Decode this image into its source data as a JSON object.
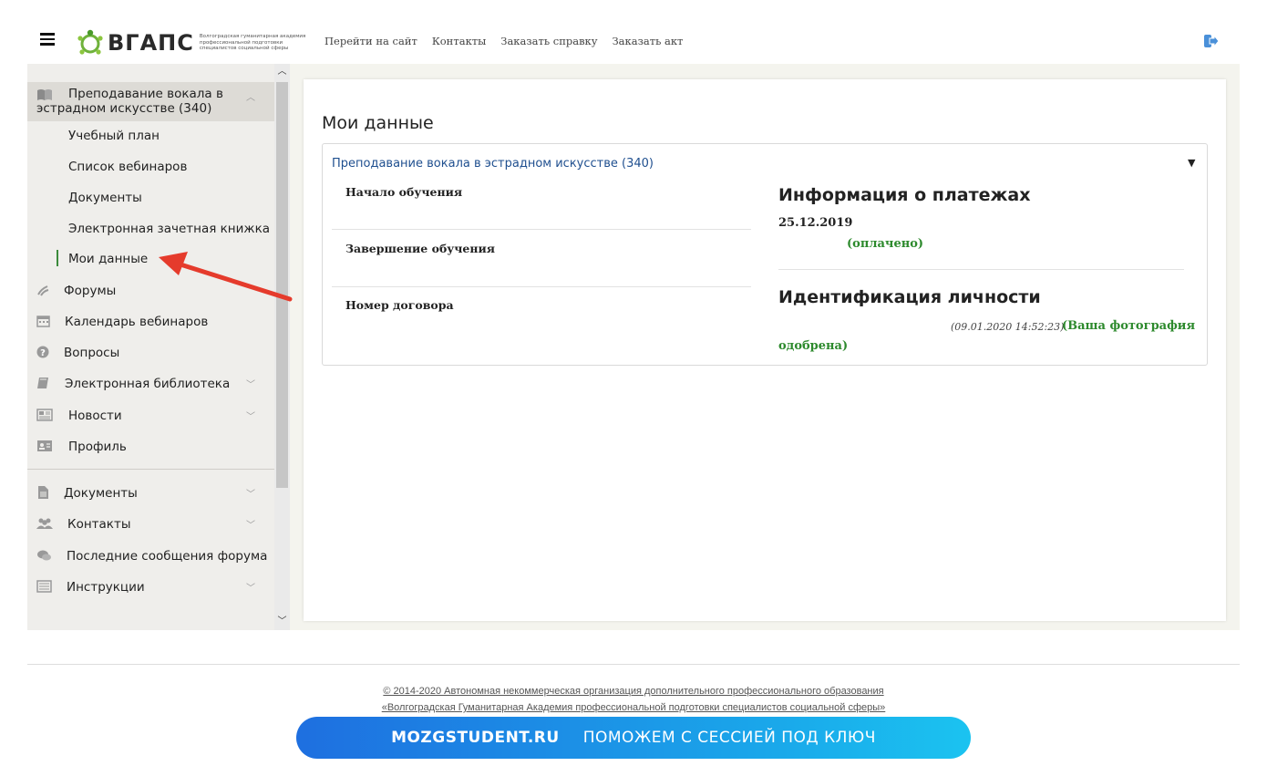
{
  "header": {
    "logo_text": "ВГАПС",
    "logo_subtitle": "Волгоградская гуманитарная академия профессиональной подготовки специалистов социальной сферы",
    "nav": [
      "Перейти на сайт",
      "Контакты",
      "Заказать справку",
      "Заказать акт"
    ],
    "logout_icon": "logout-icon"
  },
  "sidebar": {
    "course": {
      "label": "Преподавание вокала в эстрадном искусстве (340)",
      "icon": "book-icon",
      "expanded": true,
      "children": [
        "Учебный план",
        "Список вебинаров",
        "Документы",
        "Электронная зачетная книжка",
        "Мои данные"
      ],
      "active_child": "Мои данные"
    },
    "items": [
      {
        "label": "Форумы",
        "icon": "forum-icon",
        "has_children": false
      },
      {
        "label": "Календарь вебинаров",
        "icon": "calendar-icon",
        "has_children": false
      },
      {
        "label": "Вопросы",
        "icon": "question-icon",
        "has_children": false
      },
      {
        "label": "Электронная библиотека",
        "icon": "library-icon",
        "has_children": true
      },
      {
        "label": "Новости",
        "icon": "news-icon",
        "has_children": true
      },
      {
        "label": "Профиль",
        "icon": "profile-icon",
        "has_children": false
      }
    ],
    "items_bottom": [
      {
        "label": "Документы",
        "icon": "document-icon",
        "has_children": true
      },
      {
        "label": "Контакты",
        "icon": "contacts-icon",
        "has_children": true
      },
      {
        "label": "Последние сообщения форума",
        "icon": "messages-icon",
        "has_children": false
      },
      {
        "label": "Инструкции",
        "icon": "instructions-icon",
        "has_children": true
      }
    ]
  },
  "main": {
    "title": "Мои данные",
    "panel": {
      "header": "Преподавание вокала в эстрадном искусстве (340)",
      "fields": [
        {
          "label": "Начало обучения",
          "value": ""
        },
        {
          "label": "Завершение обучения",
          "value": ""
        },
        {
          "label": "Номер договора",
          "value": ""
        }
      ],
      "payments": {
        "title": "Информация о платежах",
        "date": "25.12.2019",
        "status": "(оплачено)"
      },
      "identification": {
        "title": "Идентификация личности",
        "timestamp": "(09.01.2020 14:52:23)",
        "status_line1": "(Ваша фотография",
        "status_line2": "одобрена)"
      }
    }
  },
  "footer": {
    "copyright_line1": "© 2014-2020 Автономная некоммерческая  организация дополнительного профессионального образования",
    "copyright_line2": "«Волгоградская Гуманитарная Академия профессиональной подготовки специалистов социальной сферы»"
  },
  "promo": {
    "brand": "MOZGSTUDENT.RU",
    "slogan": "ПОМОЖЕМ С СЕССИЕЙ ПОД КЛЮЧ"
  },
  "colors": {
    "link_blue": "#1f4f8f",
    "status_green": "#2d8a2d",
    "sidebar_bg": "#efeeeb",
    "active_bar": "#3b8a3b",
    "promo_gradient_start": "#1e6fe0",
    "promo_gradient_end": "#1bc3f0",
    "arrow_red": "#e53b2c"
  }
}
